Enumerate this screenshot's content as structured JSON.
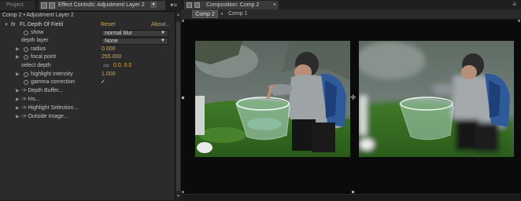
{
  "left_panel": {
    "tabs": {
      "project": "Project",
      "effect_controls": "Effect Controls: Adjustment Layer 2",
      "close": "×",
      "menu": "▾≡"
    },
    "breadcrumb": "Comp 2 • Adjustment Layer 2",
    "effect": {
      "fx_label": "fx",
      "name": "FL Depth Of Field",
      "reset": "Reset",
      "about": "About..."
    },
    "properties": {
      "show_label": "show",
      "show_value": "normal blur",
      "depth_layer_label": "depth layer",
      "depth_layer_value": "None",
      "radius_label": "radius",
      "radius_value": "0.000",
      "focal_point_label": "focal point",
      "focal_point_value": "255.000",
      "select_depth_label": "select depth",
      "select_depth_value": "0.0, 0.0",
      "highlight_intensity_label": "highlight intensity",
      "highlight_intensity_value": "1.000",
      "gamma_correction_label": "gamma correction",
      "gamma_correction_checked": "✓"
    },
    "groups": [
      "-> Depth Buffer...",
      "Iris...",
      "-> Highlight Selection...",
      "-> Outside Image..."
    ]
  },
  "right_panel": {
    "title": "Composition: Comp 2",
    "close": "×",
    "menu": "≡",
    "subtabs": {
      "active": "Comp 2",
      "inactive": "Comp 1"
    }
  },
  "colors": {
    "accent_value": "#e0a436",
    "panel_bg": "#2b2b2b",
    "viewer_bg": "#0b0b0b"
  }
}
